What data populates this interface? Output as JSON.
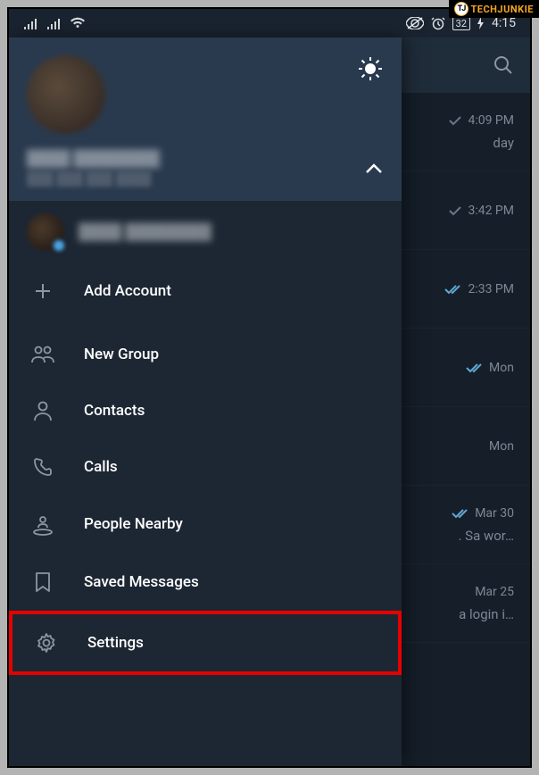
{
  "watermark": {
    "logo_text": "TJ",
    "text": "TECHJUNKIE"
  },
  "status_bar": {
    "battery_level": "32",
    "time": "4:15"
  },
  "backdrop": {
    "chats": [
      {
        "check": "single",
        "time": "4:09 PM",
        "preview": "day"
      },
      {
        "check": "single",
        "time": "3:42 PM",
        "preview": ""
      },
      {
        "check": "double",
        "time": "2:33 PM",
        "preview": ""
      },
      {
        "check": "double",
        "time": "Mon",
        "preview": ""
      },
      {
        "check": "",
        "time": "Mon",
        "preview": ""
      },
      {
        "check": "double",
        "time": "Mar 30",
        "preview": ". Sa wor…"
      },
      {
        "check": "",
        "time": "Mar 25",
        "preview": "a login i…"
      }
    ]
  },
  "drawer": {
    "user_name": "████ ████████",
    "user_phone": "███ ███ ███ ████",
    "account_name": "████ ████████",
    "add_account": "Add Account",
    "menu": {
      "new_group": "New Group",
      "contacts": "Contacts",
      "calls": "Calls",
      "people_nearby": "People Nearby",
      "saved_messages": "Saved Messages",
      "settings": "Settings"
    }
  }
}
